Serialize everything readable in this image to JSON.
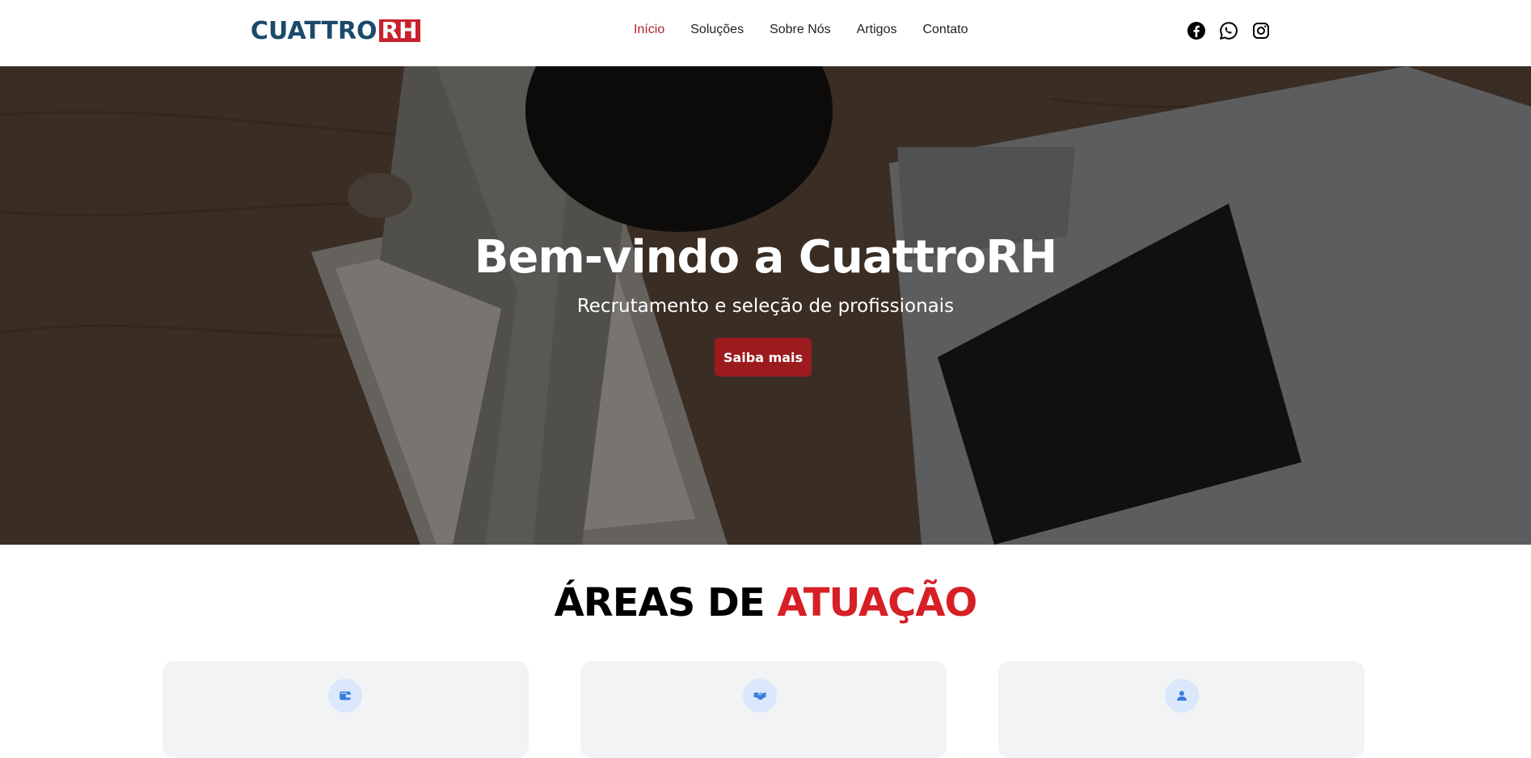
{
  "header": {
    "logo": {
      "main": "CUATTRO",
      "accent": "RH"
    },
    "nav": [
      {
        "label": "Início",
        "active": true
      },
      {
        "label": "Soluções"
      },
      {
        "label": "Sobre Nós"
      },
      {
        "label": "Artigos"
      },
      {
        "label": "Contato"
      }
    ],
    "social": [
      "facebook-icon",
      "whatsapp-icon",
      "instagram-icon"
    ]
  },
  "hero": {
    "title": "Bem-vindo a CuattroRH",
    "subtitle": "Recrutamento e seleção de profissionais",
    "button": "Saiba mais"
  },
  "areas": {
    "title_part1": "ÁREAS DE ",
    "title_part2": "ATUAÇÃO",
    "cards": [
      {
        "icon": "wallet-icon"
      },
      {
        "icon": "handshake-icon"
      },
      {
        "icon": "user-icon"
      }
    ]
  },
  "colors": {
    "brand_blue": "#1b4a6b",
    "brand_red": "#c9202b",
    "active_nav": "#b3202a",
    "hero_button": "#9b1b1f",
    "section_accent": "#d71f26",
    "card_bg": "#f2f3f5",
    "icon_bg": "#dbe7fb",
    "icon_color": "#3b7ddd"
  }
}
